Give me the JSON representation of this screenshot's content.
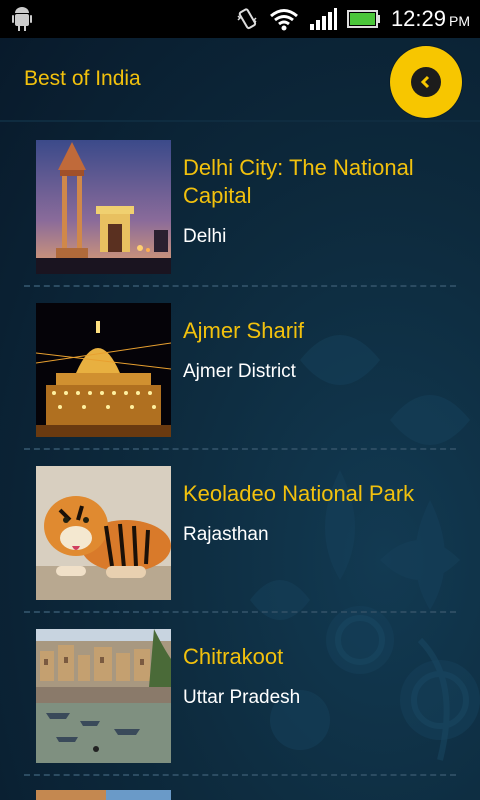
{
  "status_bar": {
    "time": "12:29",
    "ampm": "PM"
  },
  "header": {
    "title": "Best of India"
  },
  "colors": {
    "accent": "#f2c10d",
    "background": "#0d2a3d",
    "button": "#f7c600"
  },
  "items": [
    {
      "title": "Delhi City: The National Capital",
      "subtitle": "Delhi",
      "image_icon": "india-gate-image"
    },
    {
      "title": "Ajmer Sharif",
      "subtitle": "Ajmer District",
      "image_icon": "dargah-image"
    },
    {
      "title": "Keoladeo National Park",
      "subtitle": "Rajasthan",
      "image_icon": "tiger-image"
    },
    {
      "title": "Chitrakoot",
      "subtitle": "Uttar Pradesh",
      "image_icon": "river-ghats-image"
    }
  ]
}
